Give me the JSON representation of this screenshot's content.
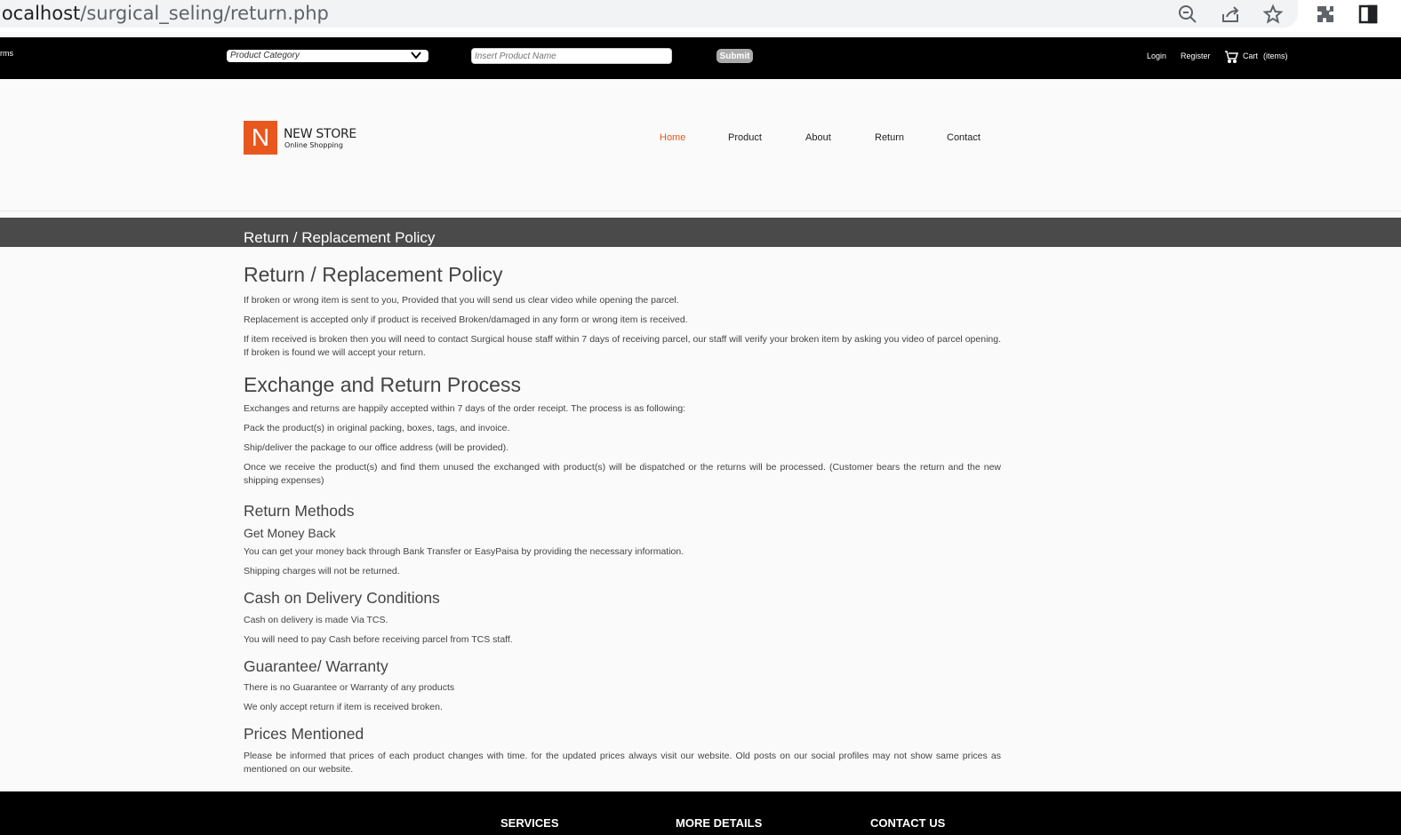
{
  "browser": {
    "url_host": "localhost",
    "url_path": "/surgical_seling/return.php",
    "icons": [
      "zoom-out-icon",
      "share-icon",
      "star-icon",
      "extensions-icon",
      "sidebar-icon"
    ]
  },
  "topbar": {
    "left_fragment": "rms",
    "category_placeholder": "Product Category",
    "search_placeholder": "Insert Product Name",
    "submit_label": "Submit",
    "login": "Login",
    "register": "Register",
    "cart": "Cart",
    "cart_items": "(items)"
  },
  "brand": {
    "letter": "N",
    "name": "NEW STORE",
    "tagline": "Online Shopping",
    "accent_color": "#e8571e"
  },
  "nav": {
    "home": "Home",
    "product": "Product",
    "about": "About",
    "return": "Return",
    "contact": "Contact"
  },
  "band_title": "Return / Replacement Policy",
  "policy": {
    "title": "Return / Replacement Policy",
    "p1": "If broken or wrong item is sent to you, Provided that you will send us clear video while opening the parcel.",
    "p2": "Replacement is accepted only if product is received Broken/damaged in any form or wrong item is received.",
    "p3": "If item received is broken then you will need to contact Surgical house staff within 7 days of receiving parcel, our staff will verify your broken item by asking you video of parcel opening. If broken is found we will accept your return."
  },
  "exchange": {
    "title": "Exchange and Return Process",
    "p1": "Exchanges and returns are happily accepted within 7 days of the order receipt. The process is as following:",
    "p2": "Pack the product(s) in original packing, boxes, tags, and invoice.",
    "p3": "Ship/deliver the package to our office address (will be provided).",
    "p4": "Once we receive the product(s) and find them unused the exchanged with product(s) will be dispatched or the returns will be processed. (Customer bears the return and the new shipping expenses)"
  },
  "methods": {
    "title": "Return Methods",
    "subtitle": "Get Money Back",
    "p1": "You can get your money back through Bank Transfer or EasyPaisa by providing the necessary information.",
    "p2": "Shipping charges will not be returned."
  },
  "cod": {
    "title": "Cash on Delivery Conditions",
    "p1": "Cash on delivery is made Via TCS.",
    "p2": "You will need to pay Cash before receiving parcel from TCS staff."
  },
  "warranty": {
    "title": "Guarantee/ Warranty",
    "p1": "There is no Guarantee or Warranty of any products",
    "p2": "We only accept return if item is received broken."
  },
  "prices": {
    "title": "Prices Mentioned",
    "p1": "Please be informed that prices of each product changes with time. for the updated prices always visit our website. Old posts on our social profiles may not show same prices as mentioned on our website."
  },
  "footer": {
    "services": "SERVICES",
    "more_details": "MORE DETAILS",
    "contact_us": "CONTACT US"
  }
}
